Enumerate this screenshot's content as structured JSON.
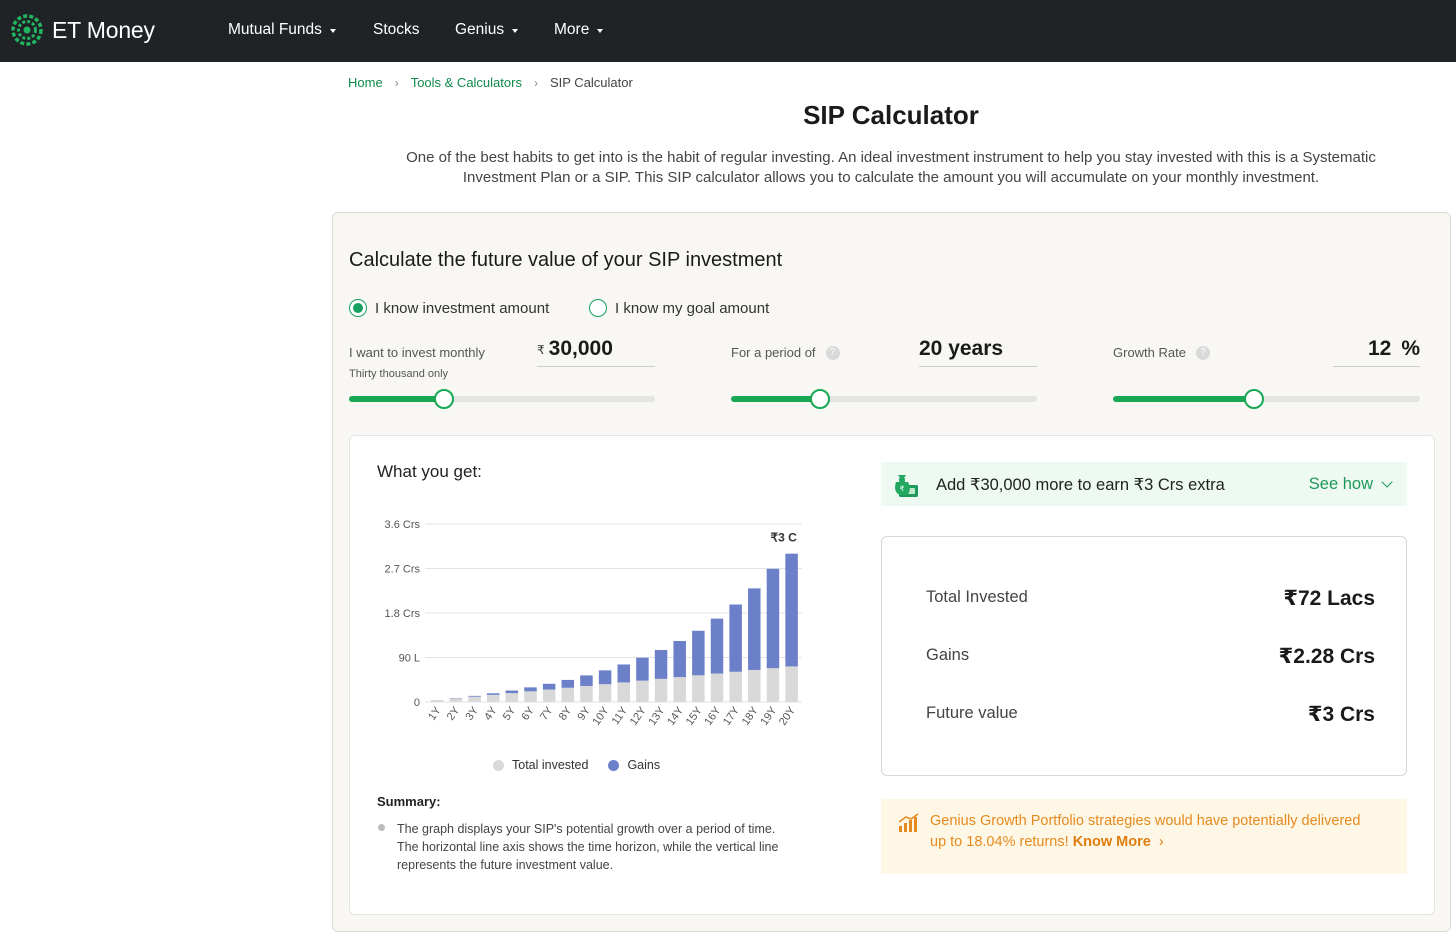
{
  "nav": {
    "brand": "ET Money",
    "items": [
      {
        "label": "Mutual Funds",
        "dropdown": true
      },
      {
        "label": "Stocks",
        "dropdown": false
      },
      {
        "label": "Genius",
        "dropdown": true
      },
      {
        "label": "More",
        "dropdown": true
      }
    ]
  },
  "breadcrumb": {
    "home": "Home",
    "tools": "Tools & Calculators",
    "current": "SIP Calculator",
    "sep": "›"
  },
  "page": {
    "title": "SIP Calculator",
    "intro": "One of the best habits to get into is the habit of regular investing. An ideal investment instrument to help you stay invested with this is a Systematic Investment Plan or a SIP. This SIP calculator allows you to calculate the amount you will accumulate on your monthly investment."
  },
  "calculator": {
    "heading": "Calculate the future value of your SIP investment",
    "mode_options": [
      "I know investment amount",
      "I know my goal amount"
    ],
    "selected_mode": 0,
    "monthly": {
      "label": "I want to invest monthly",
      "sub": "Thirty thousand only",
      "currency": "₹",
      "value": "30,000",
      "slider_fraction": 0.31
    },
    "period": {
      "label": "For a period of",
      "help": "?",
      "value": "20 years",
      "slider_fraction": 0.29
    },
    "growth": {
      "label": "Growth Rate",
      "help": "?",
      "value": "12",
      "unit": "%",
      "slider_fraction": 0.46
    }
  },
  "results": {
    "title": "What you get:",
    "promo_text": "Add ₹30,000 more to earn ₹3 Crs extra",
    "promo_action": "See how",
    "total_invested_label": "Total Invested",
    "total_invested_value": "₹72 Lacs",
    "gains_label": "Gains",
    "gains_value": "₹2.28 Crs",
    "future_label": "Future value",
    "future_value": "₹3 Crs",
    "genius_text": "Genius Growth Portfolio strategies would have potentially delivered up to 18.04% returns!",
    "genius_link": "Know More",
    "summary_title": "Summary:",
    "summary_text": "The graph displays your SIP's potential growth over a period of time. The horizontal line axis shows the time horizon, while the vertical line represents the future investment value."
  },
  "colors": {
    "brand_green": "#18a854",
    "invested": "#d9d9d9",
    "gains": "#6b80c9",
    "navbar": "#1f2326"
  },
  "chart_data": {
    "type": "bar",
    "stacked": true,
    "categories": [
      "1Y",
      "2Y",
      "3Y",
      "4Y",
      "5Y",
      "6Y",
      "7Y",
      "8Y",
      "9Y",
      "10Y",
      "11Y",
      "12Y",
      "13Y",
      "14Y",
      "15Y",
      "16Y",
      "17Y",
      "18Y",
      "19Y",
      "20Y"
    ],
    "series": [
      {
        "name": "Total invested",
        "values": [
          3.6,
          7.2,
          10.8,
          14.4,
          18,
          21.6,
          25.2,
          28.8,
          32.4,
          36,
          39.6,
          43.2,
          46.8,
          50.4,
          54,
          57.6,
          61.2,
          64.8,
          68.4,
          72
        ]
      },
      {
        "name": "Gains",
        "values": [
          0.2,
          0.7,
          1.6,
          3.2,
          5.2,
          8,
          11.6,
          15.9,
          21.4,
          28,
          36.3,
          46.4,
          58.4,
          73,
          90.1,
          111,
          136,
          165,
          201,
          228
        ]
      }
    ],
    "unit": "Lacs",
    "y_ticks": [
      "0",
      "90 L",
      "1.8 Crs",
      "2.7 Crs",
      "3.6 Crs"
    ],
    "y_tick_values": [
      0,
      90,
      180,
      270,
      360
    ],
    "ylim": [
      0,
      360
    ],
    "top_label": "₹3 C",
    "grid": true,
    "legend_position": "bottom"
  }
}
